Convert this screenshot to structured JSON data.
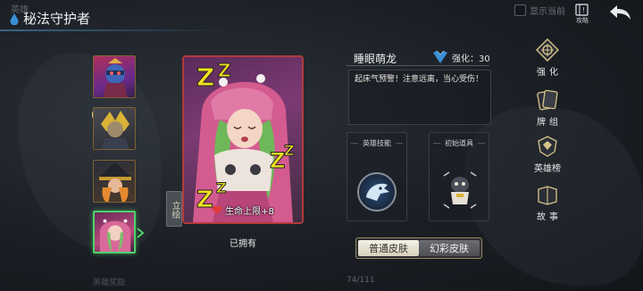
{
  "header": {
    "ghost_label": "英雄",
    "title": "秘法守护者",
    "show_current_label": "显示当前",
    "guide_label": "攻略"
  },
  "card": {
    "bonus_text": "生命上限+8",
    "lihui_tab": "立绘",
    "owned_label": "已拥有"
  },
  "info": {
    "skin_name": "睡眼萌龙",
    "enhance_text": "强化：30",
    "description": "起床气预警！注意远离，当心受伤！",
    "hero_skill_label": "英雄技能",
    "initial_item_label": "初始道具"
  },
  "skin_toggle": {
    "normal_label": "普通皮肤",
    "special_label": "幻彩皮肤"
  },
  "menu": {
    "enhance": "强化",
    "cards": "牌组",
    "ranking": "英雄榜",
    "story": "故事"
  },
  "footer": {
    "ghost_label": "英雄奖励",
    "counter": "74/111"
  },
  "colors": {
    "selected_border": "#4fd26a",
    "card_border": "#b23a3a",
    "accent_blue": "#3a8fd6"
  }
}
